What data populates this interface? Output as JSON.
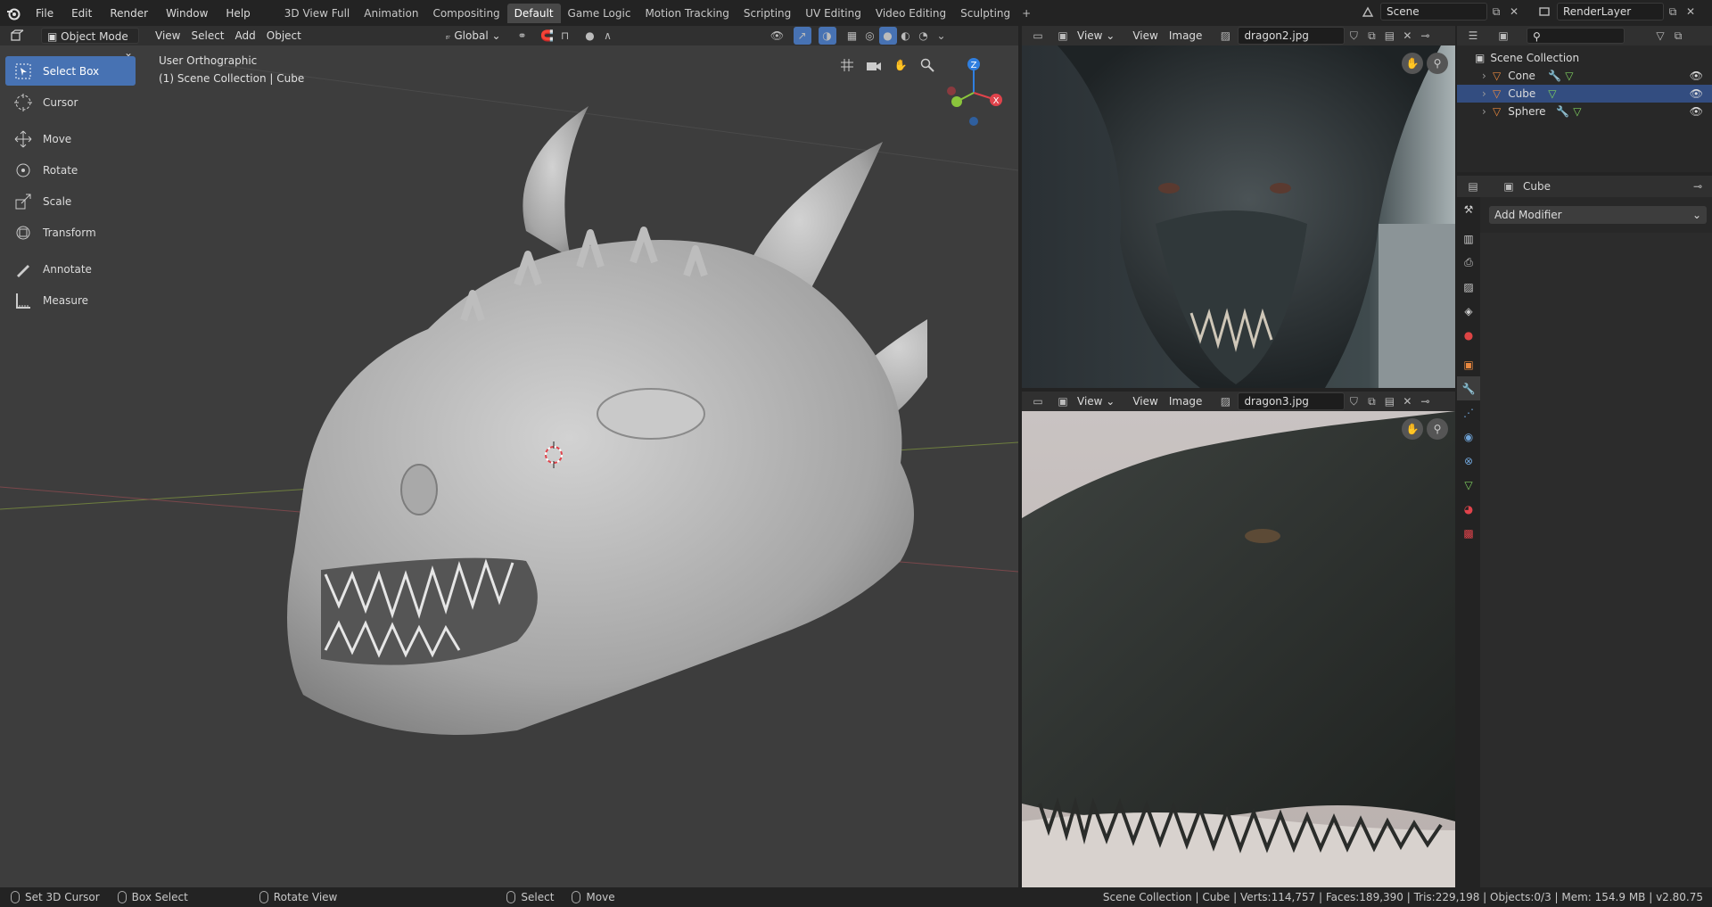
{
  "topbar": {
    "menus": [
      "File",
      "Edit",
      "Render",
      "Window",
      "Help"
    ],
    "workspaces": [
      "3D View Full",
      "Animation",
      "Compositing",
      "Default",
      "Game Logic",
      "Motion Tracking",
      "Scripting",
      "UV Editing",
      "Video Editing",
      "Sculpting"
    ],
    "active_workspace": "Default",
    "scene": "Scene",
    "render_layer": "RenderLayer"
  },
  "viewport": {
    "mode": "Object Mode",
    "menus": [
      "View",
      "Select",
      "Add",
      "Object"
    ],
    "orientation": "Global",
    "view_name": "User Orthographic",
    "collection_label": "(1) Scene Collection | Cube",
    "gizmo_axes": {
      "x": "X",
      "y": "Y",
      "z": "Z"
    },
    "tools": [
      "Select Box",
      "Cursor",
      "Move",
      "Rotate",
      "Scale",
      "Transform",
      "Annotate",
      "Measure"
    ],
    "active_tool": "Select Box"
  },
  "image_editors": [
    {
      "view": "View",
      "menus": [
        "View",
        "Image"
      ],
      "image": "dragon2.jpg"
    },
    {
      "view": "View",
      "menus": [
        "View",
        "Image"
      ],
      "image": "dragon3.jpg"
    }
  ],
  "outliner": {
    "root": "Scene Collection",
    "items": [
      "Cone",
      "Cube",
      "Sphere"
    ]
  },
  "properties": {
    "object": "Cube",
    "add_modifier": "Add Modifier"
  },
  "statusbar": {
    "hints": [
      "Set 3D Cursor",
      "Box Select",
      "Rotate View",
      "Select",
      "Move"
    ],
    "stats": "Scene Collection | Cube | Verts:114,757 | Faces:189,390 | Tris:229,198 | Objects:0/3 | Mem: 154.9 MB | v2.80.75"
  },
  "colors": {
    "accent": "#4772b3",
    "axis_x": "#e0434b",
    "axis_y": "#8bc53c",
    "axis_z": "#2f7fe0"
  }
}
